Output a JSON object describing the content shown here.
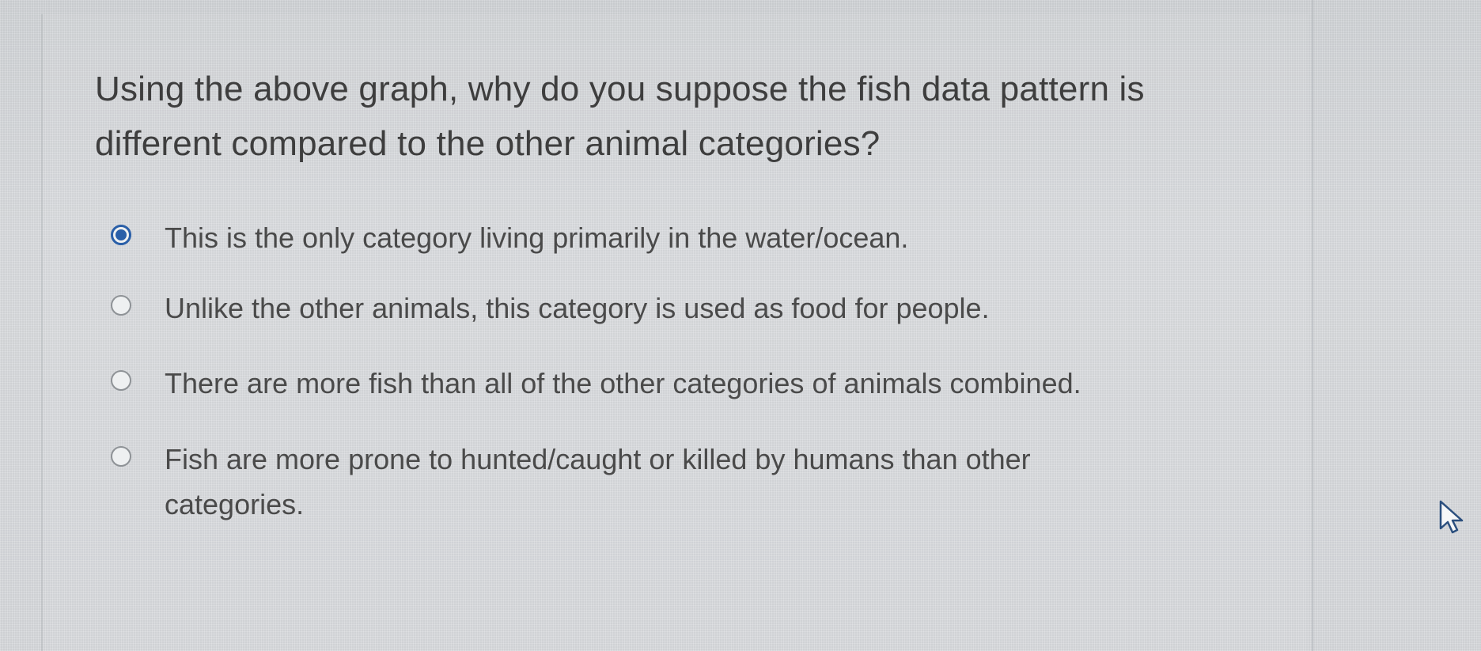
{
  "question": {
    "line1": "Using the above graph, why do you suppose the fish data pattern is",
    "line2": "different compared to the other animal categories?"
  },
  "options": [
    {
      "line1": "This is the only category living primarily in the water/ocean.",
      "line2": "",
      "selected": true
    },
    {
      "line1": "Unlike the other animals, this category is used as food for people.",
      "line2": "",
      "selected": false
    },
    {
      "line1": "There are more fish than all of the other categories of animals combined.",
      "line2": "",
      "selected": false
    },
    {
      "line1": "Fish are more prone to hunted/caught or killed by humans than other",
      "line2": "categories.",
      "selected": false
    }
  ],
  "colors": {
    "accent": "#2a5fa8",
    "text": "#3e3e3e",
    "background": "#d3d6d9"
  },
  "icons": {
    "cursor": "mouse-pointer-icon"
  }
}
